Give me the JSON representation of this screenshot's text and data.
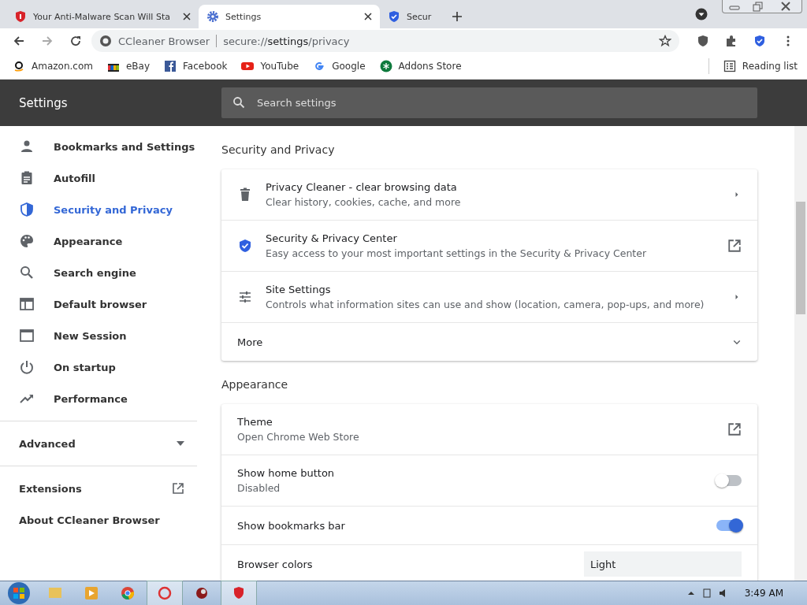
{
  "tabs": [
    {
      "title": "Your Anti-Malware Scan Will Sta",
      "selected": false
    },
    {
      "title": "Settings",
      "selected": true
    },
    {
      "title": "Secur",
      "selected": false
    }
  ],
  "address": {
    "brand": "CCleaner Browser",
    "url_prefix": "secure://",
    "url_host": "settings",
    "url_path": "/privacy"
  },
  "bookmarks": [
    {
      "label": "Amazon.com"
    },
    {
      "label": "eBay"
    },
    {
      "label": "Facebook"
    },
    {
      "label": "YouTube"
    },
    {
      "label": "Google"
    },
    {
      "label": "Addons Store"
    }
  ],
  "reading_list": "Reading list",
  "header": {
    "title": "Settings",
    "search_placeholder": "Search settings"
  },
  "sidebar": {
    "items": [
      {
        "label": "Bookmarks and Settings",
        "selected": false
      },
      {
        "label": "Autofill",
        "selected": false
      },
      {
        "label": "Security and Privacy",
        "selected": true
      },
      {
        "label": "Appearance",
        "selected": false
      },
      {
        "label": "Search engine",
        "selected": false
      },
      {
        "label": "Default browser",
        "selected": false
      },
      {
        "label": "New Session",
        "selected": false
      },
      {
        "label": "On startup",
        "selected": false
      },
      {
        "label": "Performance",
        "selected": false
      }
    ],
    "advanced": {
      "label": "Advanced",
      "expanded": false
    },
    "extensions": "Extensions",
    "about": "About CCleaner Browser"
  },
  "sections": [
    {
      "title": "Security and Privacy",
      "rows": [
        {
          "kind": "subpage",
          "title": "Privacy Cleaner - clear browsing data",
          "subtitle": "Clear history, cookies, cache, and more"
        },
        {
          "kind": "external",
          "title": "Security & Privacy Center",
          "subtitle": "Easy access to your most important settings in the Security & Privacy Center"
        },
        {
          "kind": "subpage",
          "title": "Site Settings",
          "subtitle": "Controls what information sites can use and show (location, camera, pop-ups, and more)"
        },
        {
          "kind": "more",
          "title": "More",
          "expanded": false
        }
      ]
    },
    {
      "title": "Appearance",
      "rows": [
        {
          "kind": "external",
          "title": "Theme",
          "subtitle": "Open Chrome Web Store"
        },
        {
          "kind": "toggle",
          "title": "Show home button",
          "subtitle": "Disabled",
          "on": false
        },
        {
          "kind": "toggle",
          "title": "Show bookmarks bar",
          "on": true
        },
        {
          "kind": "select",
          "title": "Browser colors",
          "value": "Light"
        }
      ]
    }
  ],
  "taskbar": {
    "time": "3:49 AM"
  }
}
